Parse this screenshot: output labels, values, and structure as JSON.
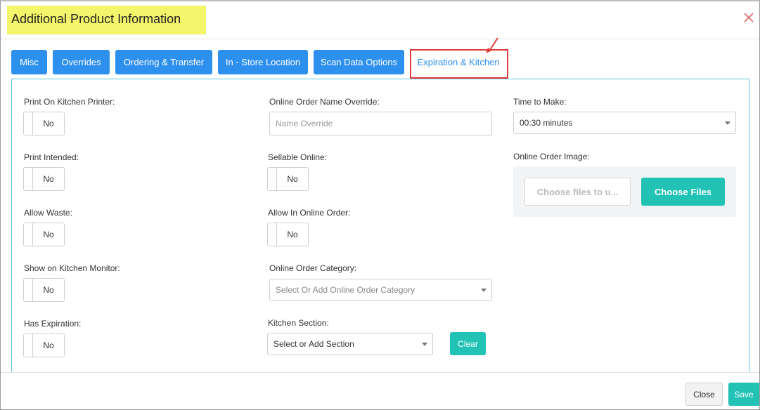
{
  "modal": {
    "title": "Additional Product Information",
    "close_icon": "close-icon",
    "accent": "#2d90ee",
    "highlight_color": "#f3f56a",
    "annotation_color": "#e03b3b"
  },
  "tabs": [
    {
      "label": "Misc",
      "active": false
    },
    {
      "label": "Overrides",
      "active": false
    },
    {
      "label": "Ordering & Transfer",
      "active": false
    },
    {
      "label": "In - Store Location",
      "active": false
    },
    {
      "label": "Scan Data Options",
      "active": false
    },
    {
      "label": "Expiration & Kitchen",
      "active": true
    }
  ],
  "left_column": {
    "print_on_kitchen_printer": {
      "label": "Print On Kitchen Printer:",
      "value": "No"
    },
    "print_intended": {
      "label": "Print Intended:",
      "value": "No"
    },
    "allow_waste": {
      "label": "Allow Waste:",
      "value": "No"
    },
    "show_on_kitchen_monitor": {
      "label": "Show on Kitchen Monitor:",
      "value": "No"
    },
    "has_expiration": {
      "label": "Has Expiration:",
      "value": "No"
    }
  },
  "middle_column": {
    "online_order_name_override": {
      "label": "Online Order Name Override:",
      "placeholder": "Name Override",
      "value": ""
    },
    "sellable_online": {
      "label": "Sellable Online:",
      "value": "No"
    },
    "allow_in_online_order": {
      "label": "Allow In Online Order:",
      "value": "No"
    },
    "online_order_category": {
      "label": "Online Order Category:",
      "placeholder": "Select Or Add Online Order Category"
    },
    "kitchen_section": {
      "label": "Kitchen Section:",
      "placeholder": "Select or Add Section",
      "clear_label": "Clear"
    }
  },
  "right_column": {
    "time_to_make": {
      "label": "Time to Make:",
      "value": "00:30 minutes"
    },
    "online_order_image": {
      "label": "Online Order Image:",
      "file_placeholder": "Choose files to u...",
      "choose_label": "Choose Files"
    }
  },
  "footer": {
    "close_label": "Close",
    "save_label": "Save"
  }
}
